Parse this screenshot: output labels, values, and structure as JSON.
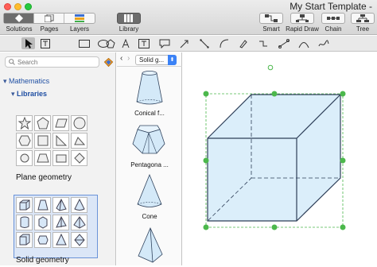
{
  "window": {
    "title": "My Start Template -"
  },
  "toolbar": {
    "left_segments": [
      "Solutions",
      "Pages",
      "Layers"
    ],
    "library_label": "Library",
    "right_buttons": [
      "Smart",
      "Rapid Draw",
      "Chain",
      "Tree"
    ]
  },
  "search": {
    "placeholder": "Search"
  },
  "tree": {
    "category": "Mathematics",
    "subcategory": "Libraries"
  },
  "libraries": [
    {
      "name": "Plane geometry"
    },
    {
      "name": "Solid geometry"
    }
  ],
  "library_select": {
    "value": "Solid g..."
  },
  "shapes": [
    {
      "label": "Conical f..."
    },
    {
      "label": "Pentagona ..."
    },
    {
      "label": "Cone"
    }
  ],
  "colors": {
    "accent": "#3b82f6",
    "selection": "#4cb84c",
    "cube_fill": "#dbeefa",
    "cube_stroke": "#2d3e58"
  }
}
